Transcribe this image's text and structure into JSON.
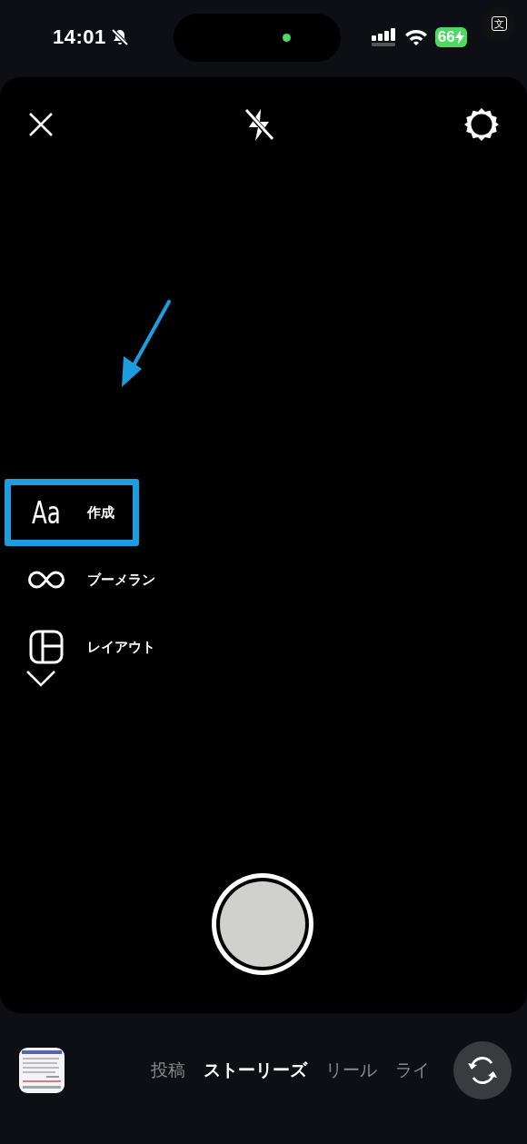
{
  "status_bar": {
    "time": "14:01",
    "silent": true,
    "battery": "66",
    "charging": true,
    "camera_in_use": true
  },
  "translate_button": {
    "glyph": "文"
  },
  "camera": {
    "flash_on": false,
    "menu": [
      {
        "kind": "text",
        "icon_text": "Aa",
        "label": "作成",
        "highlighted": true
      },
      {
        "kind": "boomerang",
        "label": "ブーメラン",
        "highlighted": false
      },
      {
        "kind": "layout",
        "label": "レイアウト",
        "highlighted": false
      }
    ],
    "menu_expanded": false
  },
  "modes": [
    {
      "label": "投稿",
      "selected": false
    },
    {
      "label": "ストーリーズ",
      "selected": true
    },
    {
      "label": "リール",
      "selected": false
    },
    {
      "label": "ライ",
      "selected": false
    }
  ]
}
